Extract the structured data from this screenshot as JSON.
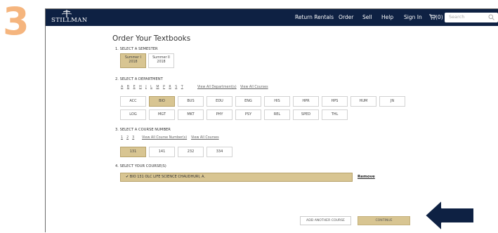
{
  "step_number": "3",
  "header": {
    "logo_text": "STILLMAN",
    "nav": [
      "Return Rentals",
      "Order",
      "Sell",
      "Help",
      "Sign In"
    ],
    "cart_count": "(0)",
    "search_placeholder": "Search"
  },
  "page_title": "Order Your Textbooks",
  "semester": {
    "label": "1. SELECT A SEMESTER",
    "options": [
      {
        "line1": "Summer I",
        "line2": "2018",
        "selected": true
      },
      {
        "line1": "Summer II",
        "line2": "2018",
        "selected": false
      }
    ]
  },
  "department": {
    "label": "2. SELECT A DEPARTMENT",
    "letters": [
      "A",
      "B",
      "E",
      "H",
      "J",
      "L",
      "M",
      "P",
      "R",
      "S",
      "T"
    ],
    "view_all_departments": "View All Department(s)",
    "view_all_courses": "View All Courses",
    "row1": [
      "ACC",
      "BIO",
      "BUS",
      "EDU",
      "ENG",
      "HIS",
      "HPR",
      "HPS",
      "HUM",
      "JN"
    ],
    "row2": [
      "LOG",
      "MGT",
      "MKT",
      "PHY",
      "PSY",
      "REL",
      "SPED",
      "THL"
    ],
    "selected": "BIO"
  },
  "course_number": {
    "label": "3. SELECT A COURSE NUMBER",
    "numbers": [
      "1",
      "2",
      "3"
    ],
    "view_all_numbers": "View All Course Number(s)",
    "view_all_courses": "View All Courses",
    "options": [
      "131",
      "141",
      "232",
      "334"
    ],
    "selected": "131"
  },
  "your_courses": {
    "label": "4. SELECT YOUR COURSE(S)",
    "selected_course": "BIO 131 OLC  LIFE SCIENCE CHAUDHURI, A.",
    "remove_label": "Remove"
  },
  "actions": {
    "add_another": "ADD ANOTHER COURSE",
    "continue": "CONTINUE"
  },
  "colors": {
    "header_bg": "#0e2143",
    "selected_bg": "#d8c592",
    "step_number": "#f5b57e",
    "arrow": "#0e2143"
  }
}
